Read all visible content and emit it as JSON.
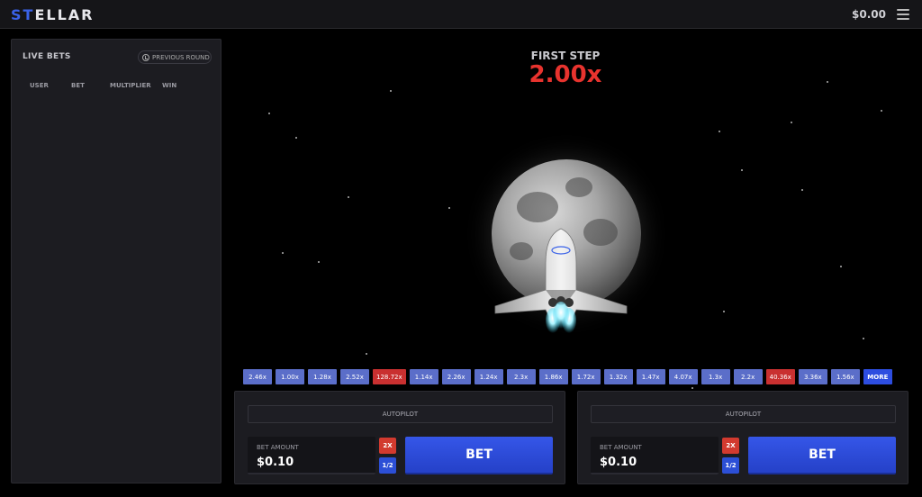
{
  "header": {
    "logo_prefix": "ST",
    "logo_rest": "ELLAR",
    "balance": "$0.00"
  },
  "live_bets": {
    "title": "LIVE BETS",
    "previous_round": "PREVIOUS ROUND",
    "columns": [
      "USER",
      "BET",
      "MULTIPLIER",
      "WIN"
    ]
  },
  "game": {
    "status_label": "FIRST STEP",
    "multiplier": "2.00x"
  },
  "history": [
    {
      "value": "2.46x",
      "color": "#5b6ec9"
    },
    {
      "value": "1.00x",
      "color": "#5b6ec9"
    },
    {
      "value": "1.28x",
      "color": "#5b6ec9"
    },
    {
      "value": "2.52x",
      "color": "#5b6ec9"
    },
    {
      "value": "128.72x",
      "color": "#c93030"
    },
    {
      "value": "1.14x",
      "color": "#5b6ec9"
    },
    {
      "value": "2.26x",
      "color": "#5b6ec9"
    },
    {
      "value": "1.24x",
      "color": "#5b6ec9"
    },
    {
      "value": "2.3x",
      "color": "#5b6ec9"
    },
    {
      "value": "1.86x",
      "color": "#5b6ec9"
    },
    {
      "value": "1.72x",
      "color": "#5b6ec9"
    },
    {
      "value": "1.32x",
      "color": "#5b6ec9"
    },
    {
      "value": "1.47x",
      "color": "#5b6ec9"
    },
    {
      "value": "4.07x",
      "color": "#5b6ec9"
    },
    {
      "value": "1.3x",
      "color": "#5b6ec9"
    },
    {
      "value": "2.2x",
      "color": "#5b6ec9"
    },
    {
      "value": "40.36x",
      "color": "#c93030"
    },
    {
      "value": "3.36x",
      "color": "#5b6ec9"
    },
    {
      "value": "1.56x",
      "color": "#5b6ec9"
    }
  ],
  "history_more": "MORE",
  "bet_panels": [
    {
      "autopilot": "AUTOPILOT",
      "amount_label": "BET AMOUNT",
      "amount": "$0.10",
      "double": "2X",
      "half": "1/2",
      "bet": "BET"
    },
    {
      "autopilot": "AUTOPILOT",
      "amount_label": "BET AMOUNT",
      "amount": "$0.10",
      "double": "2X",
      "half": "1/2",
      "bet": "BET"
    }
  ],
  "colors": {
    "accent": "#2d4de0",
    "danger": "#e8332e",
    "panel": "#1c1c21"
  }
}
